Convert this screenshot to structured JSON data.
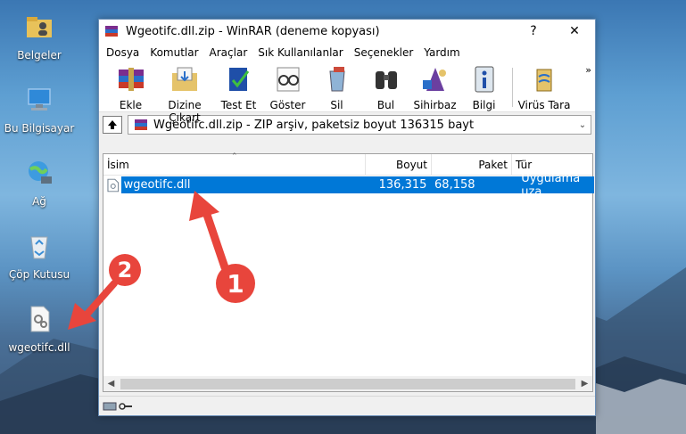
{
  "desktop": {
    "icons": [
      {
        "label": "Belgeler"
      },
      {
        "label": "Bu Bilgisayar"
      },
      {
        "label": "Ağ"
      },
      {
        "label": "Çöp Kutusu"
      },
      {
        "label": "wgeotifc.dll"
      }
    ]
  },
  "window": {
    "title": "Wgeotifc.dll.zip - WinRAR (deneme kopyası)",
    "help_label": "?",
    "close_label": "✕",
    "menu": [
      "Dosya",
      "Komutlar",
      "Araçlar",
      "Sık Kullanılanlar",
      "Seçenekler",
      "Yardım"
    ],
    "toolbar": {
      "buttons": [
        "Ekle",
        "Dizine Çıkart",
        "Test Et",
        "Göster",
        "Sil",
        "Bul",
        "Sihirbaz",
        "Bilgi",
        "Virüs Tara"
      ],
      "more": "»"
    },
    "address": {
      "text": "Wgeotifc.dll.zip - ZIP arşiv, paketsiz boyut 136315 bayt"
    },
    "columns": [
      "İsim",
      "Boyut",
      "Paket",
      "Tür"
    ],
    "files": [
      {
        "name": "wgeotifc.dll",
        "size": "136,315",
        "packed": "68,158",
        "type": "Uygulama uza"
      }
    ]
  },
  "annotations": {
    "badge1": "1",
    "badge2": "2",
    "accent": "#e8453c"
  }
}
